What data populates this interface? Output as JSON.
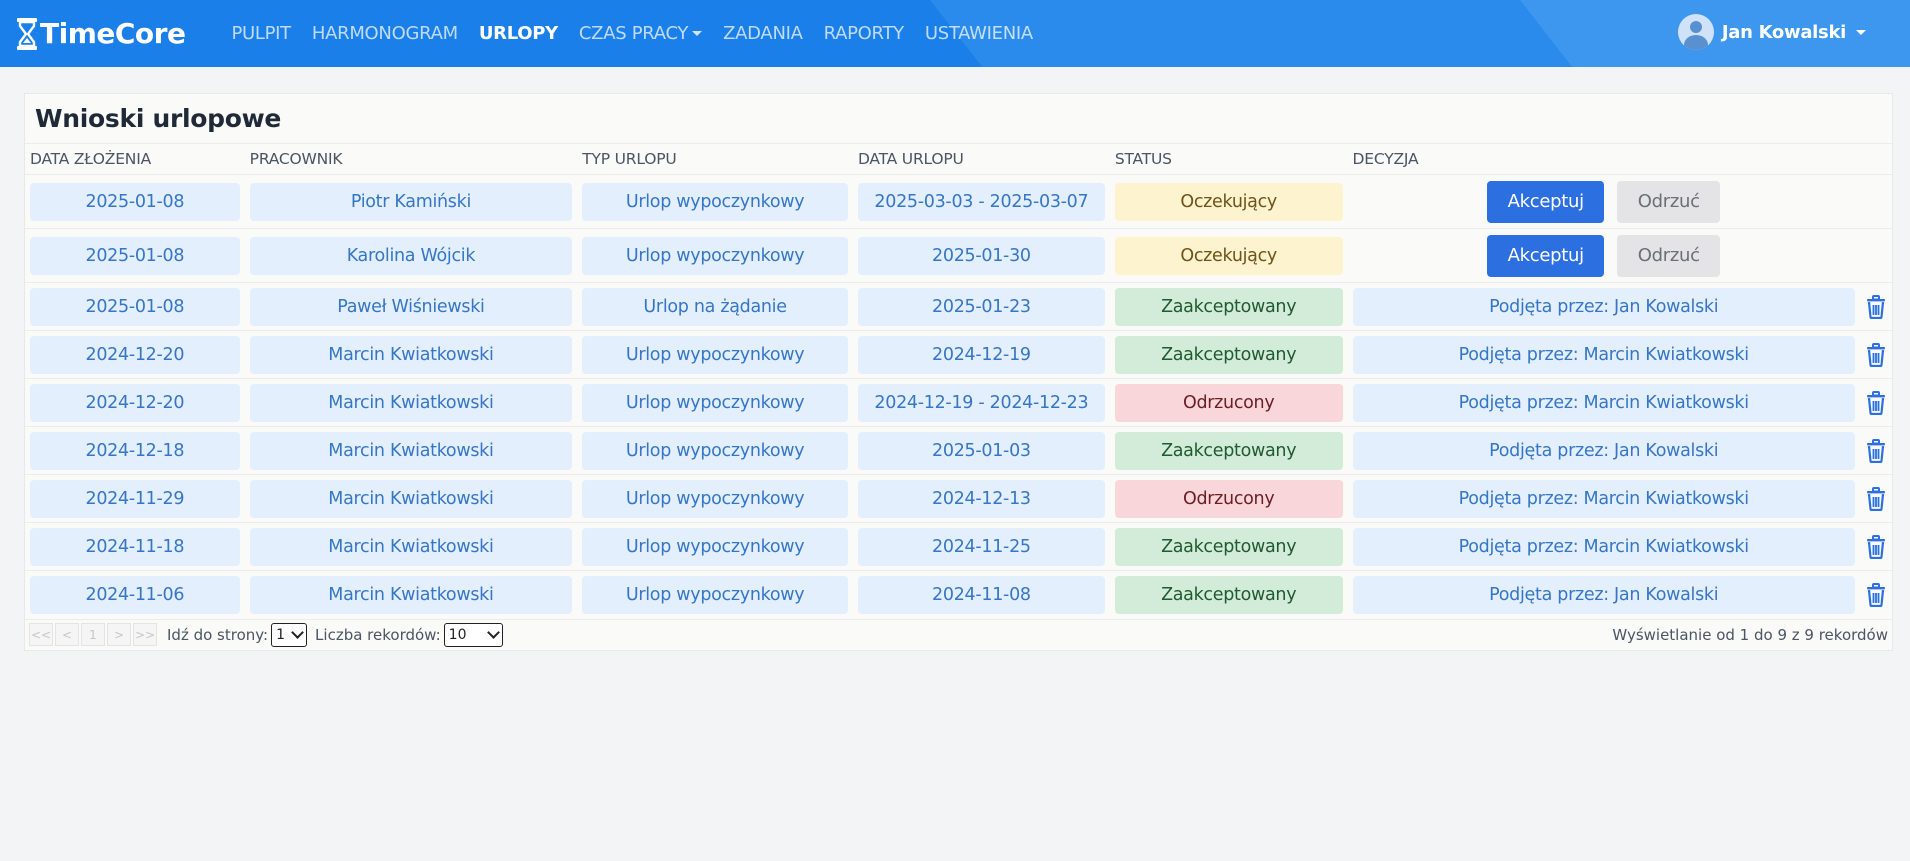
{
  "app": {
    "brand": "TimeCore",
    "brand_icon": "hourglass-icon"
  },
  "nav": {
    "items": [
      {
        "label": "PULPIT",
        "active": false
      },
      {
        "label": "HARMONOGRAM",
        "active": false
      },
      {
        "label": "URLOPY",
        "active": true
      },
      {
        "label": "CZAS PRACY",
        "active": false,
        "dropdown": true
      },
      {
        "label": "ZADANIA",
        "active": false
      },
      {
        "label": "RAPORTY",
        "active": false
      },
      {
        "label": "USTAWIENIA",
        "active": false
      }
    ],
    "user": {
      "name": "Jan Kowalski",
      "icon": "user-avatar-icon"
    }
  },
  "page": {
    "title": "Wnioski urlopowe"
  },
  "table": {
    "columns": [
      "DATA ZŁOŻENIA",
      "PRACOWNIK",
      "TYP URLOPU",
      "DATA URLOPU",
      "STATUS",
      "DECYZJA"
    ],
    "accept_label": "Akceptuj",
    "reject_label": "Odrzuć",
    "rows": [
      {
        "submitted": "2025-01-08",
        "employee": "Piotr Kamiński",
        "type": "Urlop wypoczynkowy",
        "dates": "2025-03-03 - 2025-03-07",
        "status": "Oczekujący",
        "status_kind": "pending",
        "decision": ""
      },
      {
        "submitted": "2025-01-08",
        "employee": "Karolina Wójcik",
        "type": "Urlop wypoczynkowy",
        "dates": "2025-01-30",
        "status": "Oczekujący",
        "status_kind": "pending",
        "decision": ""
      },
      {
        "submitted": "2025-01-08",
        "employee": "Paweł Wiśniewski",
        "type": "Urlop na żądanie",
        "dates": "2025-01-23",
        "status": "Zaakceptowany",
        "status_kind": "accepted",
        "decision": "Podjęta przez: Jan Kowalski"
      },
      {
        "submitted": "2024-12-20",
        "employee": "Marcin Kwiatkowski",
        "type": "Urlop wypoczynkowy",
        "dates": "2024-12-19",
        "status": "Zaakceptowany",
        "status_kind": "accepted",
        "decision": "Podjęta przez: Marcin Kwiatkowski"
      },
      {
        "submitted": "2024-12-20",
        "employee": "Marcin Kwiatkowski",
        "type": "Urlop wypoczynkowy",
        "dates": "2024-12-19 - 2024-12-23",
        "status": "Odrzucony",
        "status_kind": "rejected",
        "decision": "Podjęta przez: Marcin Kwiatkowski"
      },
      {
        "submitted": "2024-12-18",
        "employee": "Marcin Kwiatkowski",
        "type": "Urlop wypoczynkowy",
        "dates": "2025-01-03",
        "status": "Zaakceptowany",
        "status_kind": "accepted",
        "decision": "Podjęta przez: Jan Kowalski"
      },
      {
        "submitted": "2024-11-29",
        "employee": "Marcin Kwiatkowski",
        "type": "Urlop wypoczynkowy",
        "dates": "2024-12-13",
        "status": "Odrzucony",
        "status_kind": "rejected",
        "decision": "Podjęta przez: Marcin Kwiatkowski"
      },
      {
        "submitted": "2024-11-18",
        "employee": "Marcin Kwiatkowski",
        "type": "Urlop wypoczynkowy",
        "dates": "2024-11-25",
        "status": "Zaakceptowany",
        "status_kind": "accepted",
        "decision": "Podjęta przez: Marcin Kwiatkowski"
      },
      {
        "submitted": "2024-11-06",
        "employee": "Marcin Kwiatkowski",
        "type": "Urlop wypoczynkowy",
        "dates": "2024-11-08",
        "status": "Zaakceptowany",
        "status_kind": "accepted",
        "decision": "Podjęta przez: Jan Kowalski"
      }
    ]
  },
  "pagination": {
    "buttons": [
      "<<",
      "<",
      "1",
      ">",
      ">>"
    ],
    "goto_label": "Idź do strony:",
    "page_value": "1",
    "size_label": "Liczba rekordów:",
    "size_value": "10",
    "info": "Wyświetlanie od 1 do 9 z 9 rekordów"
  },
  "colors": {
    "navbar": "#1a7fe8",
    "accept_button": "#2c6fe0",
    "pill_blue": "#e3effd",
    "status_pending": "#fdf3cf",
    "status_accepted": "#d3ecd9",
    "status_rejected": "#f9d6d9",
    "trash_icon": "#2c6fe0"
  }
}
